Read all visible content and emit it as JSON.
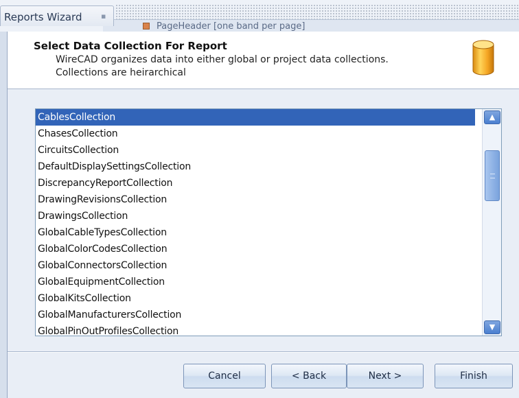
{
  "window": {
    "tab_title": "Reports Wizard",
    "background_band_text": "PageHeader [one band per page]"
  },
  "header": {
    "title": "Select Data Collection For Report",
    "description_line1": "WireCAD organizes data into either global or project data collections.",
    "description_line2": "Collections are heirarchical",
    "icon": "database-icon"
  },
  "collections": {
    "selected": "CablesCollection",
    "items": [
      "CablesCollection",
      "ChasesCollection",
      "CircuitsCollection",
      "DefaultDisplaySettingsCollection",
      "DiscrepancyReportCollection",
      "DrawingRevisionsCollection",
      "DrawingsCollection",
      "GlobalCableTypesCollection",
      "GlobalColorCodesCollection",
      "GlobalConnectorsCollection",
      "GlobalEquipmentCollection",
      "GlobalKitsCollection",
      "GlobalManufacturersCollection",
      "GlobalPinOutProfilesCollection"
    ]
  },
  "buttons": {
    "cancel": "Cancel",
    "back": "< Back",
    "next": "Next >",
    "finish": "Finish"
  },
  "colors": {
    "selection": "#3264b8",
    "header_background": "#ffffff",
    "dialog_background": "#e9eef6"
  }
}
